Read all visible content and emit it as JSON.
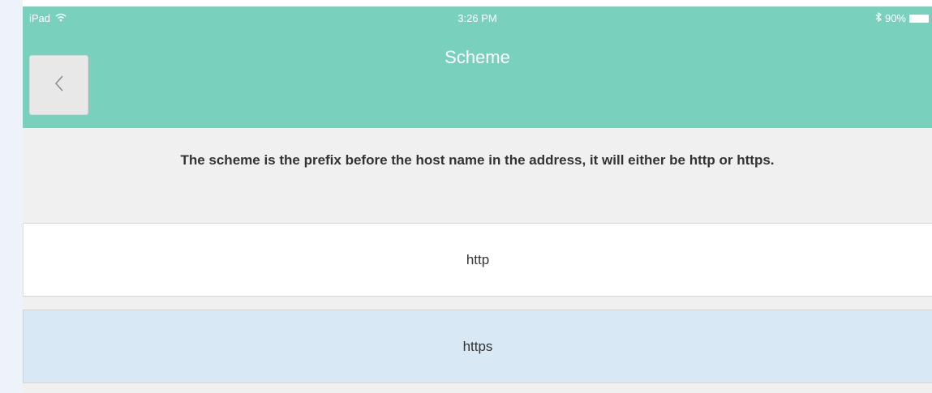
{
  "status_bar": {
    "device": "iPad",
    "wifi_icon": "wifi-icon",
    "time": "3:26 PM",
    "bluetooth_icon": "bluetooth-icon",
    "battery": "90%",
    "battery_icon": "battery-icon"
  },
  "header": {
    "title": "Scheme",
    "back_icon": "chevron-left-icon"
  },
  "description": "The scheme is the prefix before the host name in the address, it will either be http or https.",
  "options": [
    {
      "label": "http",
      "selected": false
    },
    {
      "label": "https",
      "selected": true
    }
  ],
  "colors": {
    "header_bg": "#79d0bc",
    "selected_option_bg": "#d8e8f5",
    "page_bg": "#f0f0f0"
  }
}
